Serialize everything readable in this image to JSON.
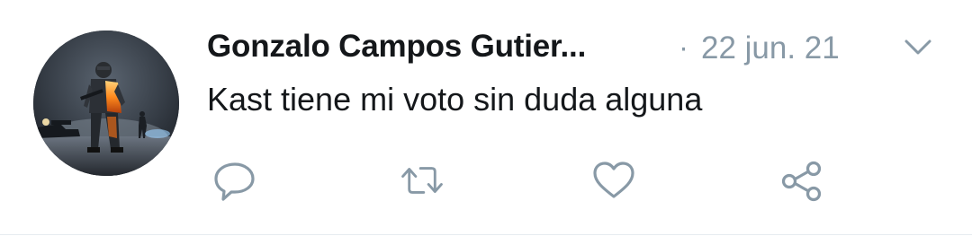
{
  "tweet": {
    "author_name": "Gonzalo Campos Gutier...",
    "separator": "·",
    "timestamp": "22 jun. 21",
    "text": "Kast tiene mi voto sin duda alguna"
  },
  "icons": {
    "avatar": "soldier-avatar",
    "menu": "chevron-down-icon",
    "reply": "reply-icon",
    "retweet": "retweet-icon",
    "like": "heart-icon",
    "share": "share-icon"
  },
  "colors": {
    "text_primary": "#14171a",
    "text_secondary": "#8899a6",
    "icon": "#8899a6",
    "divider": "#e6ecf0"
  }
}
